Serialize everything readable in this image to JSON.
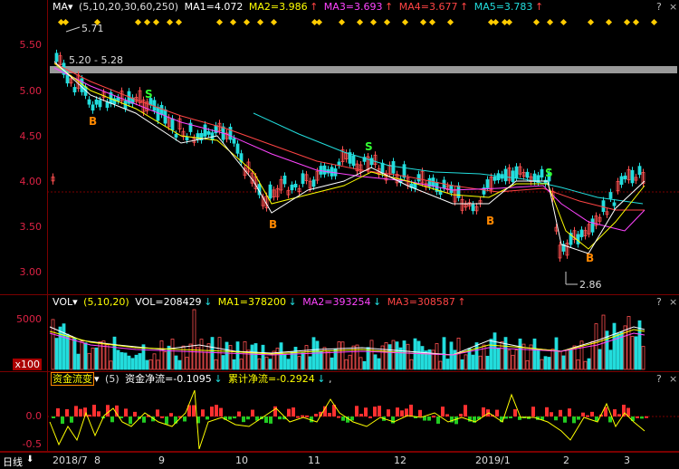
{
  "main_panel": {
    "indicator_name": "MA",
    "params": "(5,10,20,30,60,250)",
    "ma1": "MA1=4.072",
    "ma2": "MA2=3.986",
    "ma3": "MA3=3.693",
    "ma4": "MA4=3.677",
    "ma5": "MA5=3.783",
    "arrow_up": "↑",
    "y_ticks": [
      "5.50",
      "5.00",
      "4.50",
      "4.00",
      "3.50",
      "3.00"
    ],
    "price_high_label": "5.71",
    "price_low_label": "2.86",
    "band_label": "5.20 - 5.28",
    "buy_label": "B",
    "sell_label": "S"
  },
  "volume_panel": {
    "indicator_name": "VOL",
    "params": "(5,10,20)",
    "vol": "VOL=208429",
    "ma1": "MA1=378200",
    "ma2": "MA2=393254",
    "ma3": "MA3=308587",
    "arrow_down": "↓",
    "arrow_up": "↑",
    "y_tick_top": "5000",
    "unit_label": "x100"
  },
  "flow_panel": {
    "indicator_name": "资金流变",
    "params": "(5)",
    "net_flow": "资金净流=-0.1095",
    "cum_flow": "累计净流=-0.2924",
    "arrow_down": "↓",
    "trailing": ",",
    "y_ticks": [
      "0.0",
      "-0.5"
    ]
  },
  "controls": {
    "question": "?",
    "close": "×",
    "up": "↑",
    "down": "↓"
  },
  "date_axis": {
    "period_button": "日线",
    "period_arrow": "⬇",
    "labels": [
      "2018/7",
      "8",
      "9",
      "10",
      "11",
      "12",
      "2019/1",
      "2",
      "3"
    ]
  },
  "colors": {
    "ma1": "#ffffff",
    "ma2": "#ffff00",
    "ma3": "#ff44ff",
    "ma4": "#ff4444",
    "ma5": "#22dddd",
    "up": "#ff5050",
    "down": "#22dddd",
    "grid": "#7a0000"
  }
}
